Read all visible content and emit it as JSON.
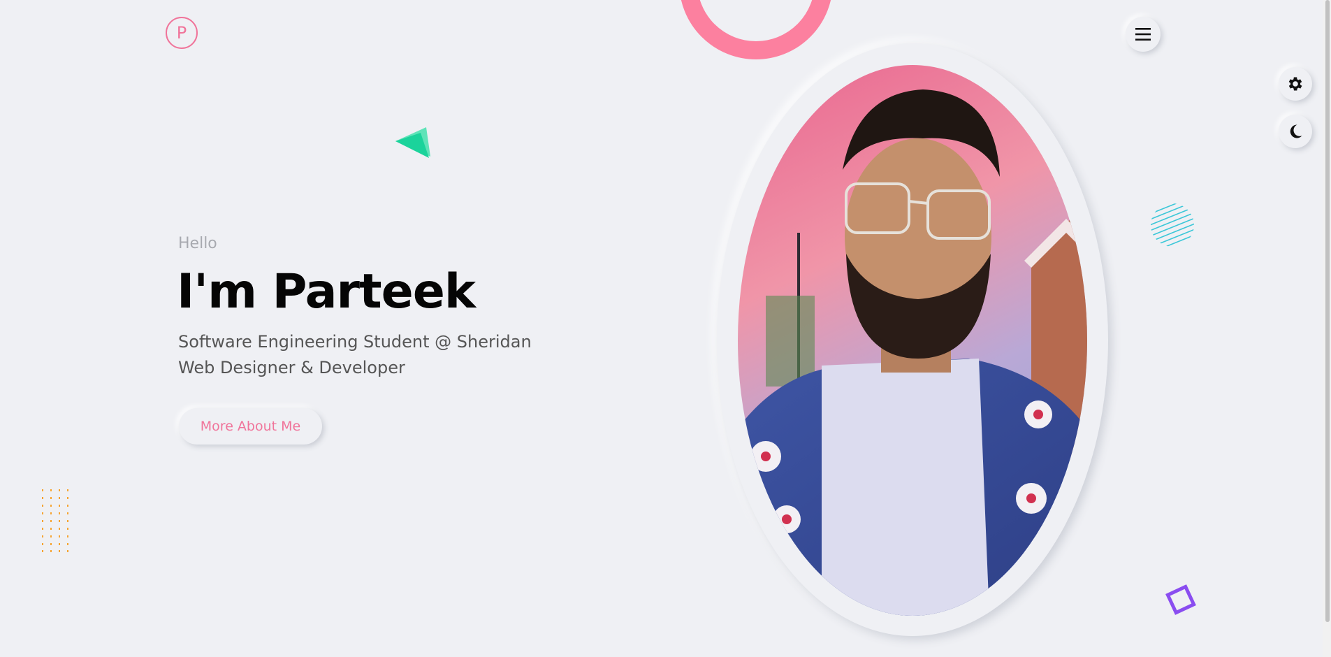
{
  "header": {
    "logo_letter": "P",
    "menu_icon": "hamburger-menu-icon"
  },
  "settings": {
    "settings_icon": "gear-icon",
    "theme_icon": "moon-icon"
  },
  "hero": {
    "greeting": "Hello",
    "name": "I'm Parteek",
    "role_line_1": "Software Engineering Student @ Sheridan",
    "role_line_2": "Web Designer & Developer",
    "cta_label": "More About Me"
  },
  "colors": {
    "background": "#eff0f4",
    "accent_pink": "#f0749a",
    "ring_pink": "#fc809f",
    "triangle_green": "#1bd39b",
    "stripes_cyan": "#3cc7d8",
    "dots_orange": "#f6a431",
    "square_purple": "#8a4df0"
  }
}
